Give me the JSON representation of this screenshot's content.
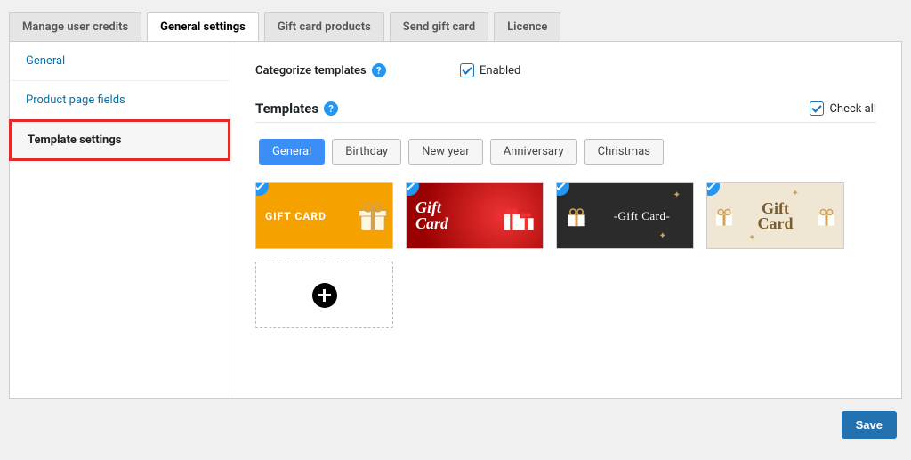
{
  "tabs": {
    "items": [
      {
        "label": "Manage user credits",
        "active": false
      },
      {
        "label": "General settings",
        "active": true
      },
      {
        "label": "Gift card products",
        "active": false
      },
      {
        "label": "Send gift card",
        "active": false
      },
      {
        "label": "Licence",
        "active": false
      }
    ]
  },
  "sidebar": {
    "items": [
      {
        "label": "General",
        "current": false
      },
      {
        "label": "Product page fields",
        "current": false
      },
      {
        "label": "Template settings",
        "current": true
      }
    ]
  },
  "categorize": {
    "label": "Categorize templates",
    "checkbox_label": "Enabled",
    "checked": true
  },
  "templates_section": {
    "title": "Templates",
    "check_all_label": "Check all",
    "check_all_checked": true
  },
  "categories": {
    "items": [
      {
        "label": "General",
        "active": true
      },
      {
        "label": "Birthday",
        "active": false
      },
      {
        "label": "New year",
        "active": false
      },
      {
        "label": "Anniversary",
        "active": false
      },
      {
        "label": "Christmas",
        "active": false
      }
    ]
  },
  "template_cards": {
    "items": [
      {
        "name": "gold-gift-card",
        "text": "GIFT CARD",
        "selected": true,
        "theme": "tpl-gold"
      },
      {
        "name": "red-gift-card",
        "text": "Gift\nCard",
        "selected": true,
        "theme": "tpl-red"
      },
      {
        "name": "dark-gift-card",
        "text": "-Gift Card-",
        "selected": true,
        "theme": "tpl-dark"
      },
      {
        "name": "cream-gift-card",
        "text": "Gift\nCard",
        "selected": true,
        "theme": "tpl-cream"
      }
    ]
  },
  "footer": {
    "save_label": "Save"
  }
}
